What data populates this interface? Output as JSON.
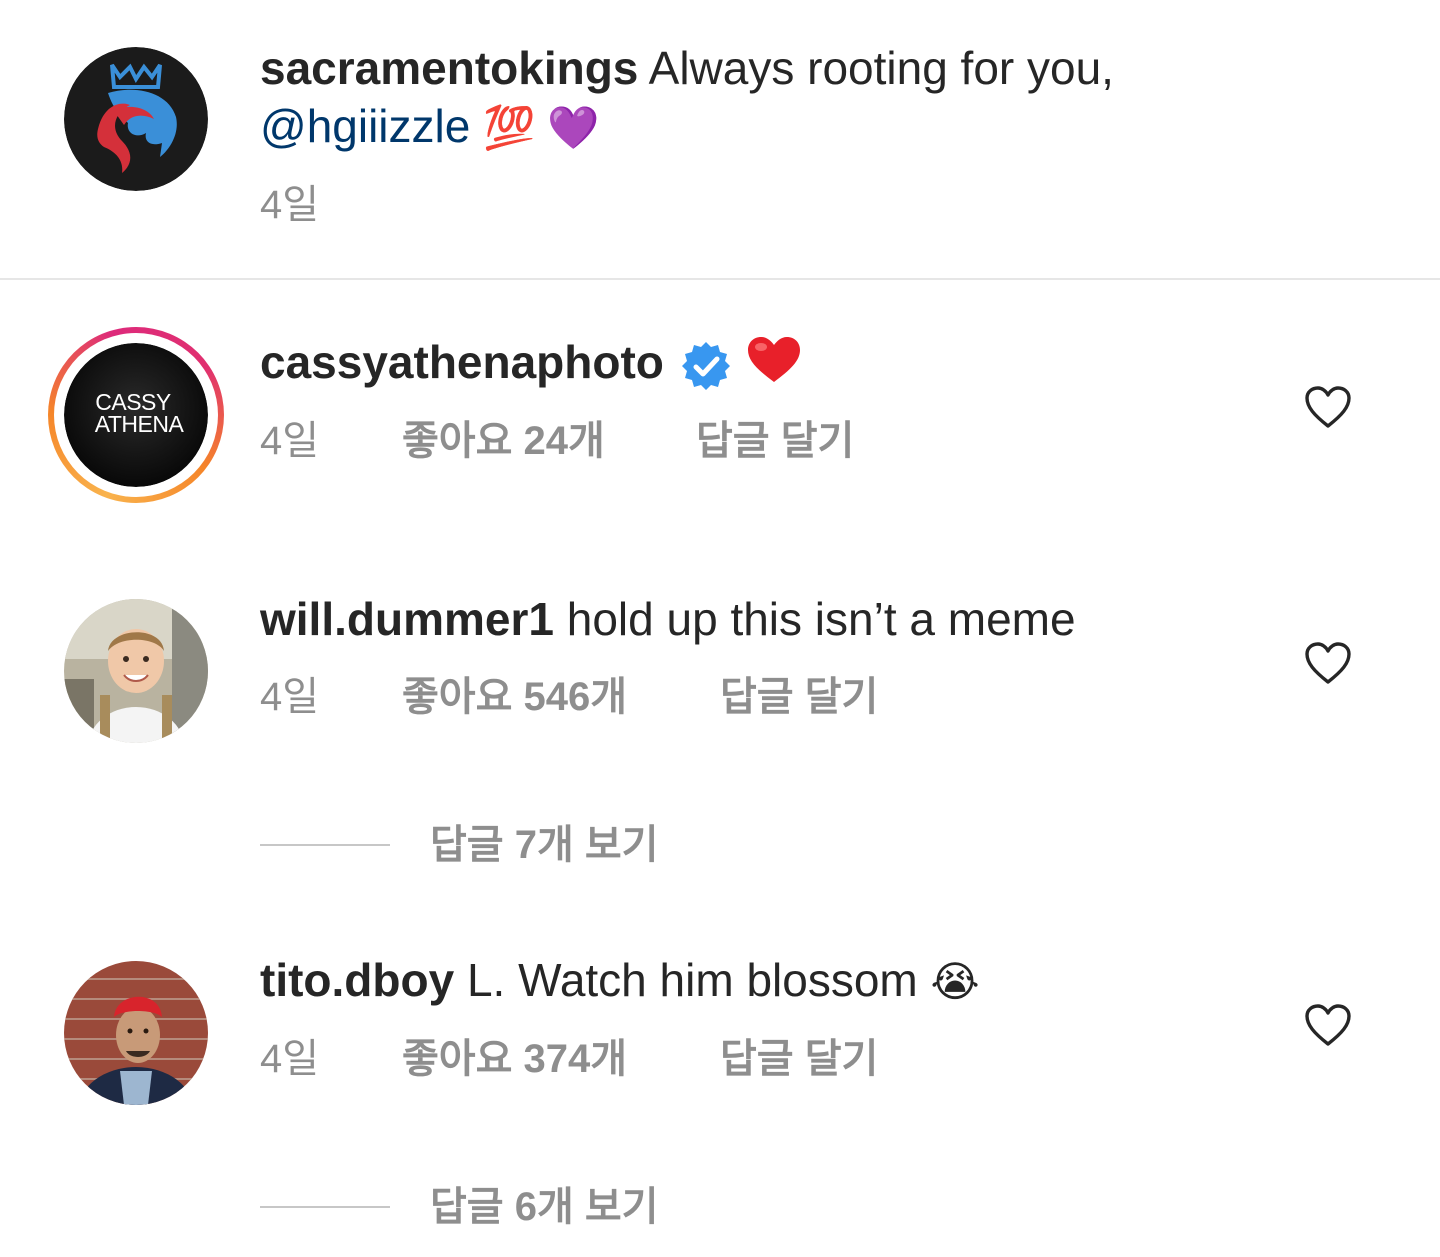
{
  "caption": {
    "username": "sacramentokings",
    "text": "Always rooting for you,",
    "mention": "@hgiiizzle",
    "emojis": "💯 💜",
    "time": "4일"
  },
  "comments": [
    {
      "username": "cassyathenaphoto",
      "avatar_text_1": "CASSY",
      "avatar_text_2": "ATHENA",
      "text": "",
      "emoji": "❤️",
      "verified": true,
      "time": "4일",
      "likes": "좋아요 24개",
      "reply": "답글 달기"
    },
    {
      "username": "will.dummer1",
      "text": "hold up this isn’t a meme",
      "time": "4일",
      "likes": "좋아요 546개",
      "reply": "답글 달기",
      "view_replies": "답글 7개 보기"
    },
    {
      "username": "tito.dboy",
      "text": "L. Watch him blossom",
      "emoji": "😭",
      "time": "4일",
      "likes": "좋아요 374개",
      "reply": "답글 달기",
      "view_replies": "답글 6개 보기"
    }
  ],
  "icons": {
    "like": "heart-outline-icon",
    "verified": "verified-badge-icon"
  },
  "colors": {
    "text": "#262626",
    "secondary": "#8e8e8e",
    "mention": "#00376b",
    "verified": "#3897f0"
  }
}
